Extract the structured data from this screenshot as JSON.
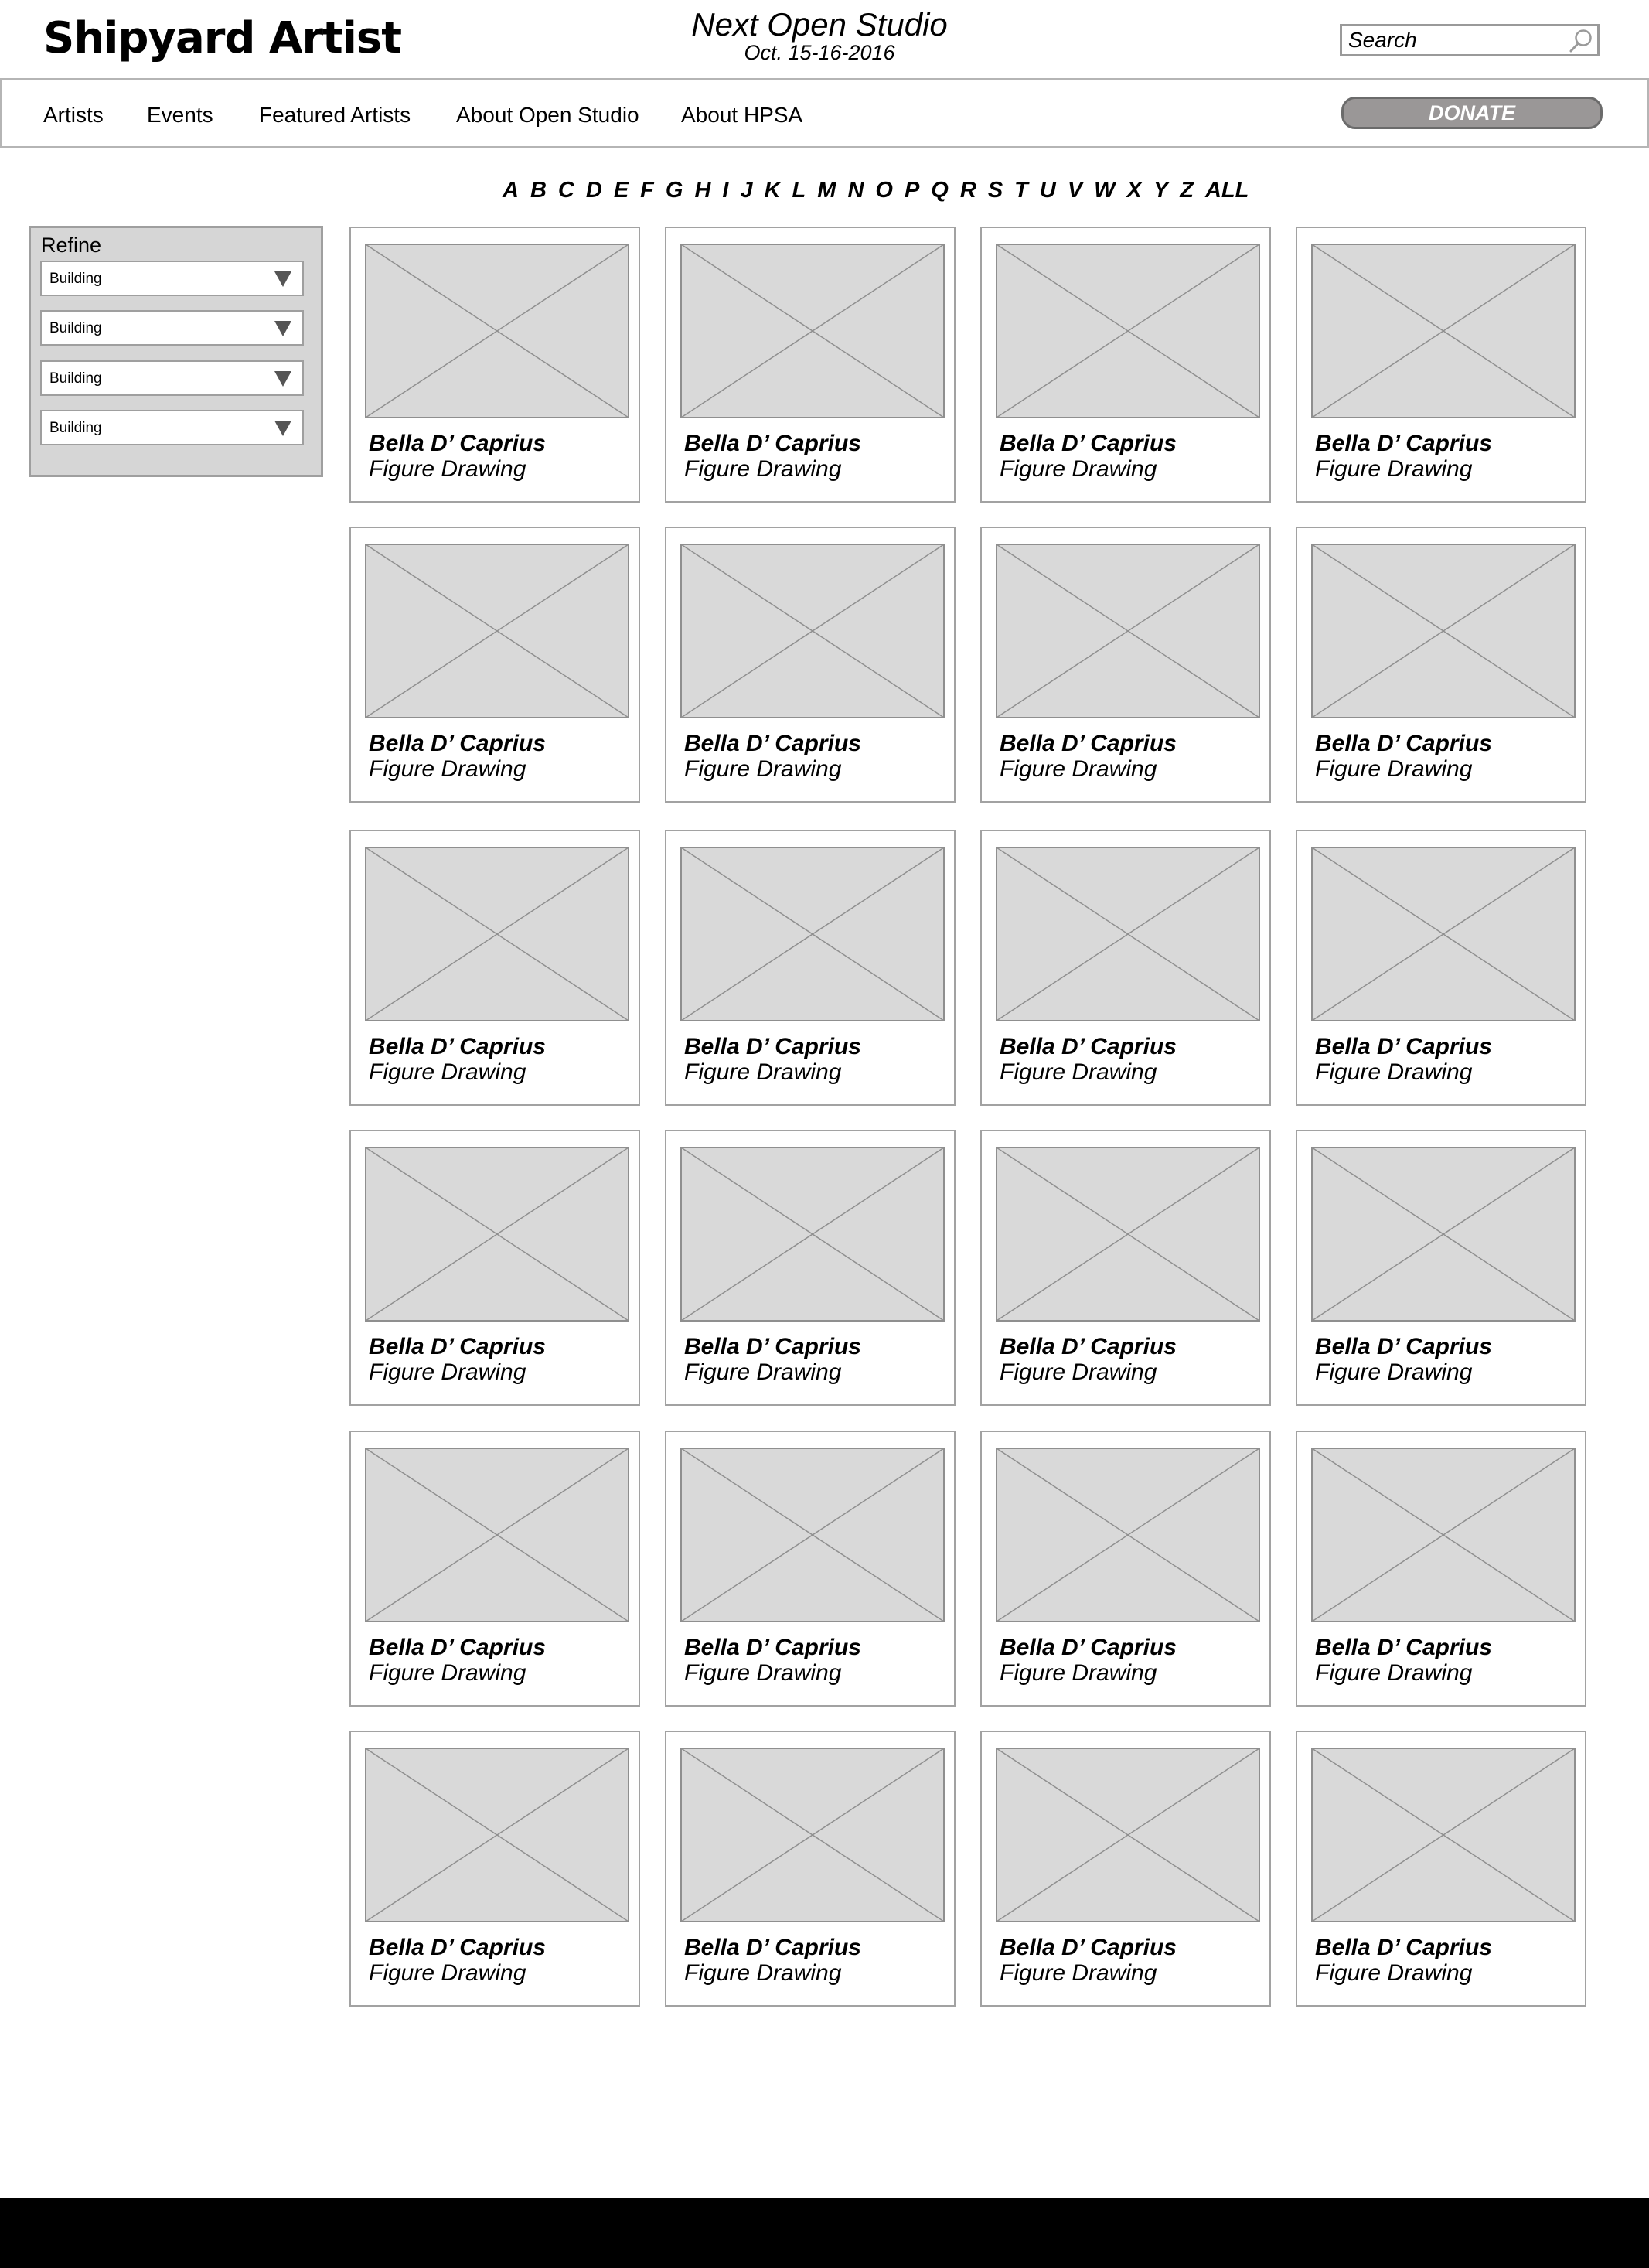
{
  "header": {
    "site_title": "Shipyard Artist",
    "event_title": "Next Open Studio",
    "event_date": "Oct. 15-16-2016",
    "search_placeholder": "Search"
  },
  "nav": {
    "items": [
      {
        "label": "Artists"
      },
      {
        "label": "Events"
      },
      {
        "label": "Featured Artists"
      },
      {
        "label": "About Open Studio"
      },
      {
        "label": "About HPSA"
      }
    ],
    "donate_label": "DONATE"
  },
  "alphabet": [
    "A",
    "B",
    "C",
    "D",
    "E",
    "F",
    "G",
    "H",
    "I",
    "J",
    "K",
    "L",
    "M",
    "N",
    "O",
    "P",
    "Q",
    "R",
    "S",
    "T",
    "U",
    "V",
    "W",
    "X",
    "Y",
    "Z",
    "ALL"
  ],
  "refine": {
    "title": "Refine",
    "filters": [
      {
        "value": "Building"
      },
      {
        "value": "Building"
      },
      {
        "value": "Building"
      },
      {
        "value": "Building"
      }
    ]
  },
  "artists": [
    {
      "name": "Bella D’ Caprius",
      "medium": "Figure Drawing"
    },
    {
      "name": "Bella D’ Caprius",
      "medium": "Figure Drawing"
    },
    {
      "name": "Bella D’ Caprius",
      "medium": "Figure Drawing"
    },
    {
      "name": "Bella D’ Caprius",
      "medium": "Figure Drawing"
    },
    {
      "name": "Bella D’ Caprius",
      "medium": "Figure Drawing"
    },
    {
      "name": "Bella D’ Caprius",
      "medium": "Figure Drawing"
    },
    {
      "name": "Bella D’ Caprius",
      "medium": "Figure Drawing"
    },
    {
      "name": "Bella D’ Caprius",
      "medium": "Figure Drawing"
    },
    {
      "name": "Bella D’ Caprius",
      "medium": "Figure Drawing"
    },
    {
      "name": "Bella D’ Caprius",
      "medium": "Figure Drawing"
    },
    {
      "name": "Bella D’ Caprius",
      "medium": "Figure Drawing"
    },
    {
      "name": "Bella D’ Caprius",
      "medium": "Figure Drawing"
    },
    {
      "name": "Bella D’ Caprius",
      "medium": "Figure Drawing"
    },
    {
      "name": "Bella D’ Caprius",
      "medium": "Figure Drawing"
    },
    {
      "name": "Bella D’ Caprius",
      "medium": "Figure Drawing"
    },
    {
      "name": "Bella D’ Caprius",
      "medium": "Figure Drawing"
    },
    {
      "name": "Bella D’ Caprius",
      "medium": "Figure Drawing"
    },
    {
      "name": "Bella D’ Caprius",
      "medium": "Figure Drawing"
    },
    {
      "name": "Bella D’ Caprius",
      "medium": "Figure Drawing"
    },
    {
      "name": "Bella D’ Caprius",
      "medium": "Figure Drawing"
    },
    {
      "name": "Bella D’ Caprius",
      "medium": "Figure Drawing"
    },
    {
      "name": "Bella D’ Caprius",
      "medium": "Figure Drawing"
    },
    {
      "name": "Bella D’ Caprius",
      "medium": "Figure Drawing"
    },
    {
      "name": "Bella D’ Caprius",
      "medium": "Figure Drawing"
    }
  ],
  "icons": {
    "search": "search-icon",
    "dropdown": "chevron-down-icon",
    "image_placeholder": "image-placeholder-icon"
  },
  "colors": {
    "donate_button": "#9a9797",
    "refine_panel": "#d6d6d6",
    "placeholder_fill": "#d9d9d9",
    "border": "#a2a2a2",
    "footer": "#000000"
  }
}
